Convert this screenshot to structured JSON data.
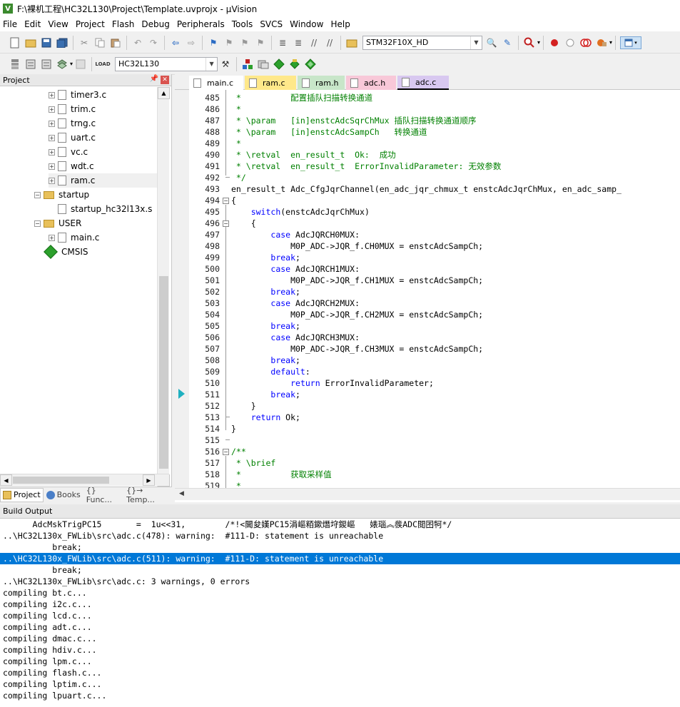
{
  "window": {
    "title": "F:\\裸机工程\\HC32L130\\Project\\Template.uvprojx - µVision"
  },
  "menu": [
    "File",
    "Edit",
    "View",
    "Project",
    "Flash",
    "Debug",
    "Peripherals",
    "Tools",
    "SVCS",
    "Window",
    "Help"
  ],
  "toolbar": {
    "device_combo": "STM32F10X_HD",
    "target_combo": "HC32L130",
    "icons": [
      "new-file-icon",
      "open-icon",
      "save-icon",
      "save-all-icon",
      "cut-icon",
      "copy-icon",
      "paste-icon",
      "undo-icon",
      "redo-icon",
      "nav-back-icon",
      "nav-forward-icon",
      "bookmark-icon",
      "bookmark-prev-icon",
      "bookmark-next-icon",
      "bookmark-clear-icon",
      "indent-icon",
      "unindent-icon",
      "comment-icon",
      "uncomment-icon",
      "find-in-files-icon",
      "find-icon",
      "debug-icon",
      "breakpoint-icon",
      "breakpoint-disable-icon",
      "breakpoint-kill-icon",
      "config-icon",
      "window-layout-icon"
    ]
  },
  "project_panel": {
    "title": "Project",
    "tree": [
      {
        "label": "timer3.c",
        "kind": "file",
        "indent": 1
      },
      {
        "label": "trim.c",
        "kind": "file",
        "indent": 1
      },
      {
        "label": "trng.c",
        "kind": "file",
        "indent": 1
      },
      {
        "label": "uart.c",
        "kind": "file",
        "indent": 1
      },
      {
        "label": "vc.c",
        "kind": "file",
        "indent": 1
      },
      {
        "label": "wdt.c",
        "kind": "file",
        "indent": 1
      },
      {
        "label": "ram.c",
        "kind": "file",
        "indent": 1
      },
      {
        "label": "startup",
        "kind": "folder",
        "indent": 0
      },
      {
        "label": "startup_hc32l13x.s",
        "kind": "file-noexp",
        "indent": 1
      },
      {
        "label": "USER",
        "kind": "folder",
        "indent": 0
      },
      {
        "label": "main.c",
        "kind": "file",
        "indent": 1
      },
      {
        "label": "CMSIS",
        "kind": "cmsis",
        "indent": 0
      }
    ],
    "bottom_tabs": [
      "Project",
      "Books",
      "{} Func...",
      "{}→ Temp..."
    ]
  },
  "editor": {
    "tabs": [
      {
        "label": "main.c",
        "color": "#ffffff"
      },
      {
        "label": "ram.c",
        "color": "#ffe88a"
      },
      {
        "label": "ram.h",
        "color": "#c8e6c9"
      },
      {
        "label": "adc.h",
        "color": "#f8c8d8"
      },
      {
        "label": "adc.c",
        "color": "#d8c8f0"
      }
    ],
    "active_tab": "adc.c",
    "lines": [
      {
        "n": "485",
        "t": " *          配置插队扫描转换通道",
        "c": "cm"
      },
      {
        "n": "486",
        "t": " *",
        "c": "cm"
      },
      {
        "n": "487",
        "t": " * \\param   [in]enstcAdcSqrChMux 插队扫描转换通道顺序",
        "c": "cm"
      },
      {
        "n": "488",
        "t": " * \\param   [in]enstcAdcSampCh   转换通道",
        "c": "cm"
      },
      {
        "n": "489",
        "t": " *",
        "c": "cm"
      },
      {
        "n": "490",
        "t": " * \\retval  en_result_t  Ok:  成功",
        "c": "cm"
      },
      {
        "n": "491",
        "t": " * \\retval  en_result_t  ErrorInvalidParameter: 无效参数",
        "c": "cm"
      },
      {
        "n": "492",
        "t": " */",
        "c": "cm"
      },
      {
        "n": "493",
        "t": "en_result_t Adc_CfgJqrChannel(en_adc_jqr_chmux_t enstcAdcJqrChMux, en_adc_samp_",
        "c": "pl"
      },
      {
        "n": "494",
        "t": "{",
        "c": "pl"
      },
      {
        "n": "495",
        "t": "    switch(enstcAdcJqrChMux)",
        "c": "kw1"
      },
      {
        "n": "496",
        "t": "    {",
        "c": "pl"
      },
      {
        "n": "497",
        "t": "        case AdcJQRCH0MUX:",
        "c": "kw1"
      },
      {
        "n": "498",
        "t": "            M0P_ADC->JQR_f.CH0MUX = enstcAdcSampCh;",
        "c": "pl"
      },
      {
        "n": "499",
        "t": "        break;",
        "c": "kwall"
      },
      {
        "n": "500",
        "t": "        case AdcJQRCH1MUX:",
        "c": "kw1"
      },
      {
        "n": "501",
        "t": "            M0P_ADC->JQR_f.CH1MUX = enstcAdcSampCh;",
        "c": "pl"
      },
      {
        "n": "502",
        "t": "        break;",
        "c": "kwall"
      },
      {
        "n": "503",
        "t": "        case AdcJQRCH2MUX:",
        "c": "kw1"
      },
      {
        "n": "504",
        "t": "            M0P_ADC->JQR_f.CH2MUX = enstcAdcSampCh;",
        "c": "pl"
      },
      {
        "n": "505",
        "t": "        break;",
        "c": "kwall"
      },
      {
        "n": "506",
        "t": "        case AdcJQRCH3MUX:",
        "c": "kw1"
      },
      {
        "n": "507",
        "t": "            M0P_ADC->JQR_f.CH3MUX = enstcAdcSampCh;",
        "c": "pl"
      },
      {
        "n": "508",
        "t": "        break;",
        "c": "kwall"
      },
      {
        "n": "509",
        "t": "        default:",
        "c": "kwall"
      },
      {
        "n": "510",
        "t": "            return ErrorInvalidParameter;",
        "c": "kw1"
      },
      {
        "n": "511",
        "t": "        break;",
        "c": "kwall"
      },
      {
        "n": "512",
        "t": "    }",
        "c": "pl"
      },
      {
        "n": "513",
        "t": "    return Ok;",
        "c": "kw1"
      },
      {
        "n": "514",
        "t": "}",
        "c": "pl"
      },
      {
        "n": "515",
        "t": "",
        "c": "pl"
      },
      {
        "n": "516",
        "t": "/**",
        "c": "cm"
      },
      {
        "n": "517",
        "t": " * \\brief",
        "c": "cm"
      },
      {
        "n": "518",
        "t": " *          获取采样值",
        "c": "cm"
      },
      {
        "n": "519",
        "t": " *",
        "c": "cm"
      }
    ]
  },
  "build_output": {
    "title": "Build Output",
    "lines": [
      "      AdcMskTrigPC15       =  1u<<31,        /*!<閫夋嫨PC15涓嶇粨鏉熸垨鍐嶇   婊瑙︽彂ADC閲囨牱*/",
      "..\\HC32L130x_FWLib\\src\\adc.c(478): warning:  #111-D: statement is unreachable",
      "          break;",
      "..\\HC32L130x_FWLib\\src\\adc.c(511): warning:  #111-D: statement is unreachable",
      "          break;",
      "..\\HC32L130x_FWLib\\src\\adc.c: 3 warnings, 0 errors",
      "compiling bt.c...",
      "compiling i2c.c...",
      "compiling lcd.c...",
      "compiling adt.c...",
      "compiling dmac.c...",
      "compiling hdiv.c...",
      "compiling lpm.c...",
      "compiling flash.c...",
      "compiling lptim.c...",
      "compiling lpuart.c..."
    ],
    "selected_index": 3
  }
}
